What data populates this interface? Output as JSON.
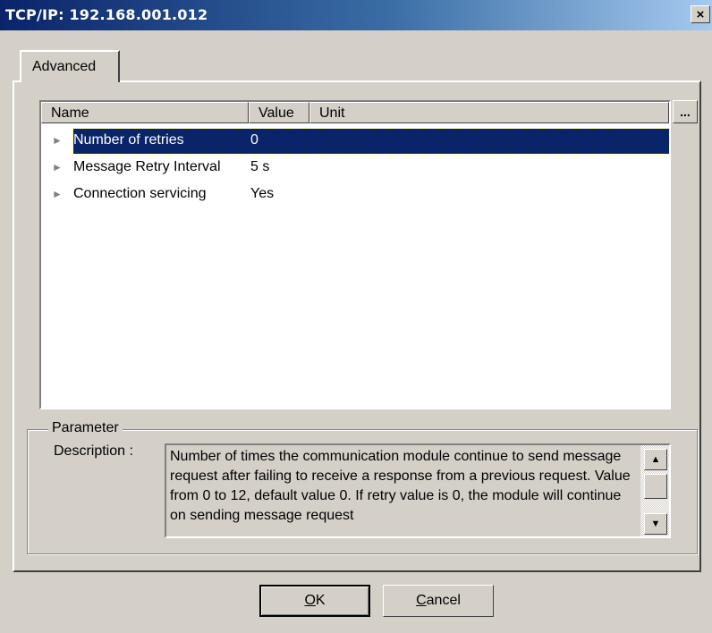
{
  "window": {
    "title": "TCP/IP: 192.168.001.012",
    "close_label": "×"
  },
  "tabs": [
    {
      "label": "Advanced"
    }
  ],
  "list": {
    "columns": {
      "name": "Name",
      "value": "Value",
      "unit": "Unit"
    },
    "rows": [
      {
        "name": "Number of retries",
        "value": "0",
        "selected": true
      },
      {
        "name": "Message Retry Interval",
        "value": "5 s",
        "selected": false
      },
      {
        "name": "Connection servicing",
        "value": "Yes",
        "selected": false
      }
    ],
    "ellipsis_label": "..."
  },
  "parameter": {
    "group_label": "Parameter",
    "description_label": "Description :",
    "description_text": "Number of times the communication module continue to send message request after failing to receive a response from a previous request. Value from 0 to 12, default value 0. If retry value is 0, the module will continue on sending message request"
  },
  "buttons": {
    "ok_accel": "O",
    "ok_rest": "K",
    "cancel_accel": "C",
    "cancel_rest": "ancel"
  }
}
